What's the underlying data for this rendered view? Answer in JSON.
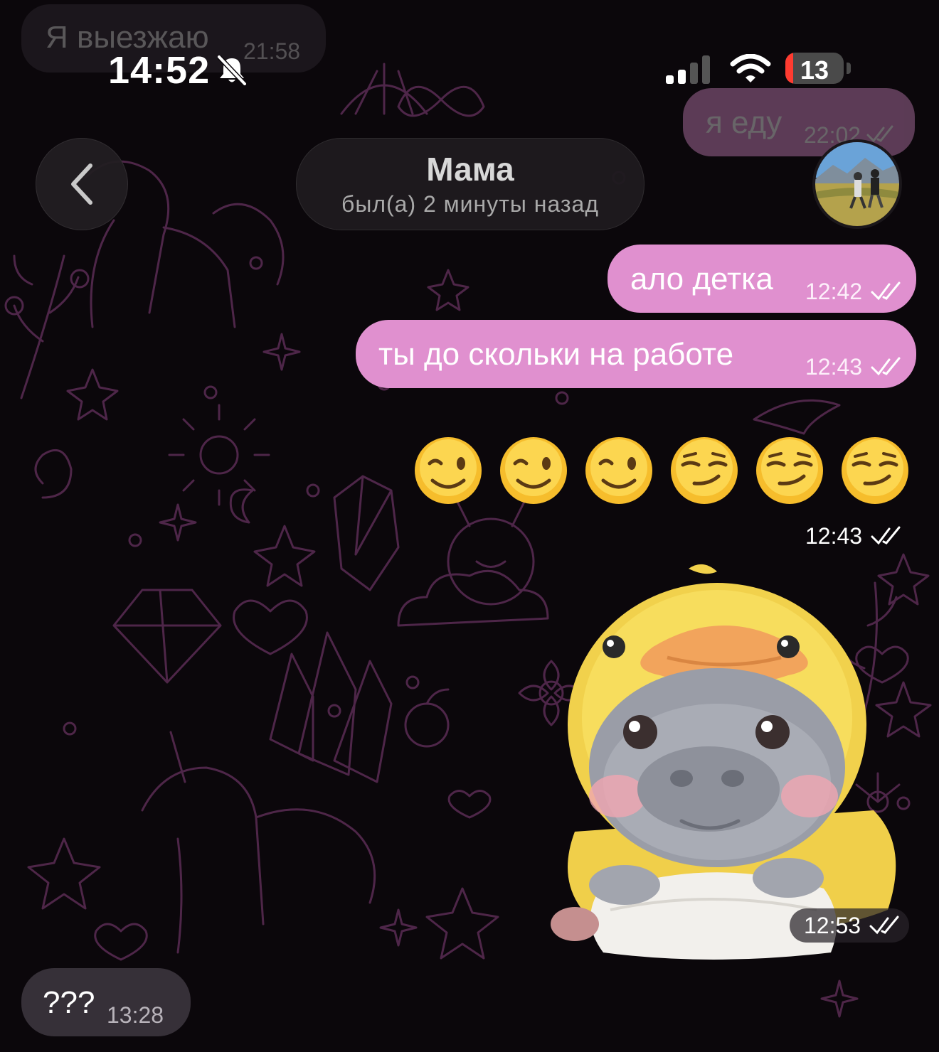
{
  "status_bar": {
    "time": "14:52",
    "battery_percent": "13",
    "battery_level": 0.13
  },
  "header": {
    "name": "Мама",
    "status": "был(а) 2 минуты назад"
  },
  "top_messages": {
    "incoming": {
      "text": "Я выезжаю",
      "time": "21:58"
    },
    "outgoing": {
      "text": "я еду",
      "time": "22:02"
    }
  },
  "messages": [
    {
      "text": "ало детка",
      "time": "12:42"
    },
    {
      "text": "ты до скольки на работе",
      "time": "12:43"
    }
  ],
  "emoji_message": {
    "emojis": [
      "😉",
      "😉",
      "😉",
      "😏",
      "😏",
      "😏"
    ],
    "time": "12:43"
  },
  "sticker_message": {
    "icon": "duck-hippo-sticker",
    "time": "12:53"
  },
  "last_incoming": {
    "text": "???",
    "time": "13:28"
  },
  "colors": {
    "outgoing_bubble": "#e090cf",
    "incoming_bubble": "#3a343c",
    "background": "#0b070b",
    "wallpaper_doodle": "#5e2e57"
  }
}
